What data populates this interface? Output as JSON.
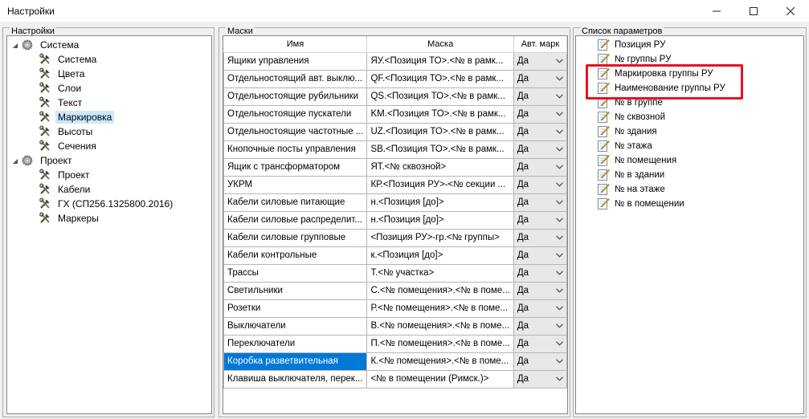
{
  "window": {
    "title": "Настройки"
  },
  "groups": {
    "settings": "Настройки",
    "masks": "Маски",
    "params": "Список параметров"
  },
  "tree": [
    {
      "label": "Система",
      "level": 0,
      "expanded": true,
      "icon": "gear-icon"
    },
    {
      "label": "Система",
      "level": 1,
      "icon": "tools-icon"
    },
    {
      "label": "Цвета",
      "level": 1,
      "icon": "tools-icon"
    },
    {
      "label": "Слои",
      "level": 1,
      "icon": "tools-icon"
    },
    {
      "label": "Текст",
      "level": 1,
      "icon": "tools-icon"
    },
    {
      "label": "Маркировка",
      "level": 1,
      "icon": "tools-icon",
      "selected": true
    },
    {
      "label": "Высоты",
      "level": 1,
      "icon": "tools-icon"
    },
    {
      "label": "Сечения",
      "level": 1,
      "icon": "tools-icon"
    },
    {
      "label": "Проект",
      "level": 0,
      "expanded": true,
      "icon": "gear-icon"
    },
    {
      "label": "Проект",
      "level": 1,
      "icon": "tools-icon"
    },
    {
      "label": "Кабели",
      "level": 1,
      "icon": "tools-icon"
    },
    {
      "label": "ГХ (СП256.1325800.2016)",
      "level": 1,
      "icon": "tools-icon"
    },
    {
      "label": "Маркеры",
      "level": 1,
      "icon": "tools-icon"
    }
  ],
  "masks": {
    "columns": [
      "Имя",
      "Маска",
      "Авт. марк"
    ],
    "rows": [
      {
        "name": "Ящики управления",
        "mask": "ЯУ.<Позиция ТО>.<№ в рамк...",
        "auto": "Да"
      },
      {
        "name": "Отдельностоящий авт. выклю...",
        "mask": "QF.<Позиция ТО>.<№ в рамк...",
        "auto": "Да"
      },
      {
        "name": "Отдельностоящие рубильники",
        "mask": "QS.<Позиция ТО>.<№ в рамк...",
        "auto": "Да"
      },
      {
        "name": "Отдельностоящие пускатели",
        "mask": "KM.<Позиция ТО>.<№ в рамк...",
        "auto": "Да"
      },
      {
        "name": "Отдельностоящие частотные ...",
        "mask": "UZ.<Позиция ТО>.<№ в рамк...",
        "auto": "Да"
      },
      {
        "name": "Кнопочные посты управления",
        "mask": "SB.<Позиция ТО>.<№ в рамк...",
        "auto": "Да"
      },
      {
        "name": "Ящик с трансформатором",
        "mask": "ЯТ.<№ сквозной>",
        "auto": "Да"
      },
      {
        "name": "УКРМ",
        "mask": "КР.<Позиция РУ>-<№ секции ...",
        "auto": "Да"
      },
      {
        "name": "Кабели силовые питающие",
        "mask": "н.<Позиция [до]>",
        "auto": "Да"
      },
      {
        "name": "Кабели силовые распределит...",
        "mask": "н.<Позиция [до]>",
        "auto": "Да"
      },
      {
        "name": "Кабели силовые групповые",
        "mask": "<Позиция РУ>-гр.<№ группы>",
        "auto": "Да"
      },
      {
        "name": "Кабели контрольные",
        "mask": "к.<Позиция [до]>",
        "auto": "Да"
      },
      {
        "name": "Трассы",
        "mask": "Т.<№ участка>",
        "auto": "Да"
      },
      {
        "name": "Светильники",
        "mask": "С.<№ помещения>.<№ в поме...",
        "auto": "Да"
      },
      {
        "name": "Розетки",
        "mask": "Р.<№ помещения>.<№ в поме...",
        "auto": "Да"
      },
      {
        "name": "Выключатели",
        "mask": "В.<№ помещения>.<№ в поме...",
        "auto": "Да"
      },
      {
        "name": "Переключатели",
        "mask": "П.<№ помещения>.<№ в поме...",
        "auto": "Да"
      },
      {
        "name": "Коробка разветвительная",
        "mask": "К.<№ помещения>.<№ в поме...",
        "auto": "Да",
        "selected": true
      },
      {
        "name": "Клавиша выключателя, перек...",
        "mask": "<№ в помещении (Римск.)>",
        "auto": "Да"
      }
    ]
  },
  "params": [
    "Позиция РУ",
    "№ группы РУ",
    "Маркировка группы РУ",
    "Наименование группы РУ",
    "№ в группе",
    "№ сквозной",
    "№ здания",
    "№ этажа",
    "№ помещения",
    "№ в здании",
    "№ на этаже",
    "№ в помещении"
  ],
  "colors": {
    "selection": "#0078d7",
    "tree_selection": "#cce8ff",
    "highlight_box": "#e81123"
  }
}
